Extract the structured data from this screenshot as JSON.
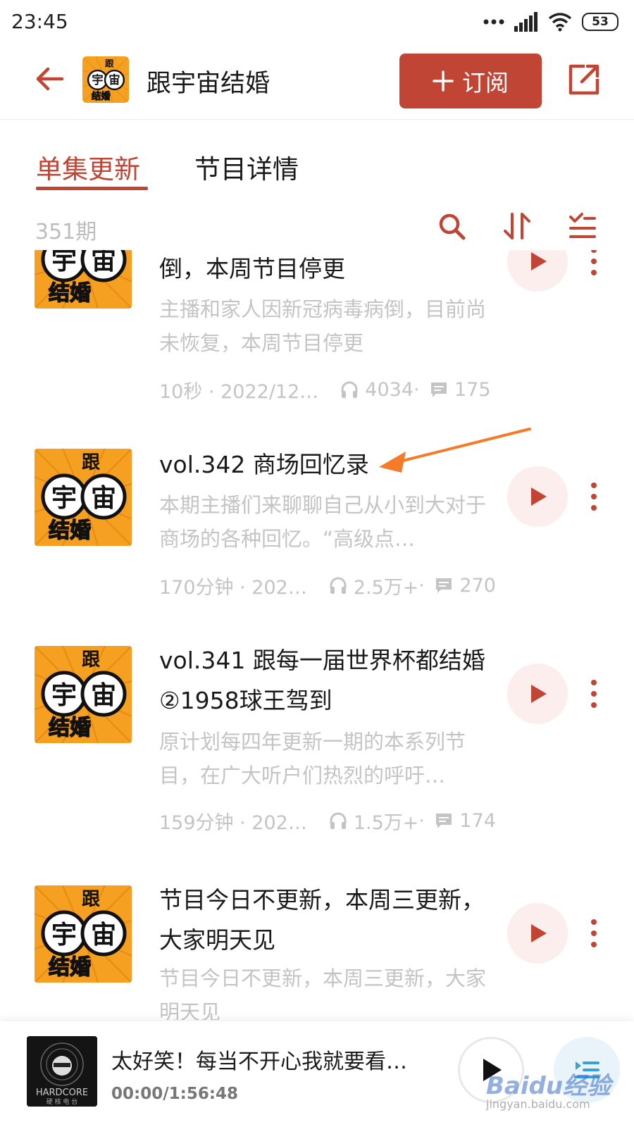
{
  "status_bar": {
    "time": "23:45",
    "battery": "53",
    "icons": [
      "dots-icon",
      "signal-icon",
      "wifi-icon",
      "battery-icon"
    ]
  },
  "header": {
    "title": "跟宇宙结婚",
    "subscribe_label": "订阅",
    "cover_text": [
      "跟",
      "宇",
      "宙",
      "结婚"
    ]
  },
  "tabs": [
    {
      "label": "单集更新",
      "active": true
    },
    {
      "label": "节目详情",
      "active": false
    }
  ],
  "toolbar": {
    "count": "351期",
    "icons": [
      "search-icon",
      "sort-icon",
      "filter-icon"
    ]
  },
  "episodes": [
    {
      "title": "倒，本周节目停更",
      "desc": "主播和家人因新冠病毒病倒，目前尚未恢复，本周节目停更",
      "duration_date": "10秒 · 2022/12…",
      "plays": "4034",
      "comments": "175"
    },
    {
      "title": "vol.342 商场回忆录",
      "desc": "本期主播们来聊聊自己从小到大对于商场的各种回忆。“高级点…",
      "duration_date": "170分钟 · 202…",
      "plays": "2.5万+",
      "comments": "270"
    },
    {
      "title": "vol.341 跟每一届世界杯都结婚②1958球王驾到",
      "desc": "原计划每四年更新一期的本系列节目，在广大听户们热烈的呼吁…",
      "duration_date": "159分钟 · 202…",
      "plays": "1.5万+",
      "comments": "174"
    },
    {
      "title": "节目今日不更新，本周三更新，大家明天见",
      "desc": "节目今日不更新，本周三更新，大家明天见",
      "duration_date": "",
      "plays": "",
      "comments": ""
    }
  ],
  "player": {
    "title": "太好笑！每当不开心我就要看…",
    "time": "00:00/1:56:48",
    "cover_text": "HARDCORE",
    "cover_subtext": "硬 核 电 台"
  },
  "watermark": {
    "brand": "Baidu经验",
    "url": "jingyan.baidu.com"
  },
  "colors": {
    "accent": "#c14534",
    "annotation_arrow": "#f47b2a",
    "cover_bg": "#f5a020"
  }
}
